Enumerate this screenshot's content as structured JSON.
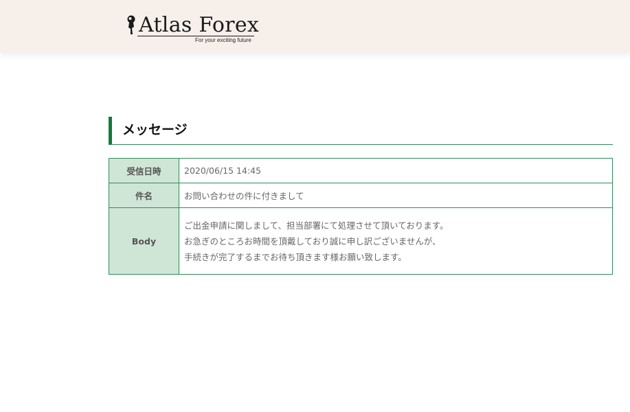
{
  "header": {
    "logo_name": "Atlas Forex",
    "logo_tagline": "For your exciting future",
    "logo_icon": "atlas-figure-icon"
  },
  "section": {
    "title": "メッセージ"
  },
  "message": {
    "rows": [
      {
        "label": "受信日時",
        "value": "2020/06/15 14:45"
      },
      {
        "label": "件名",
        "value": "お問い合わせの件に付きまして"
      }
    ],
    "body_label": "Body",
    "body_lines": [
      "ご出金申請に関しまして、担当部署にて処理させて頂いております。",
      "お急ぎのところお時間を頂戴しており誠に申し訳ございませんが、",
      "手続きが完了するまでお待ち頂きます様お願い致します。"
    ]
  },
  "colors": {
    "header_bg": "#f6efea",
    "accent": "#137a3e",
    "border": "#2e8b57",
    "label_bg": "#cfe6d6"
  }
}
